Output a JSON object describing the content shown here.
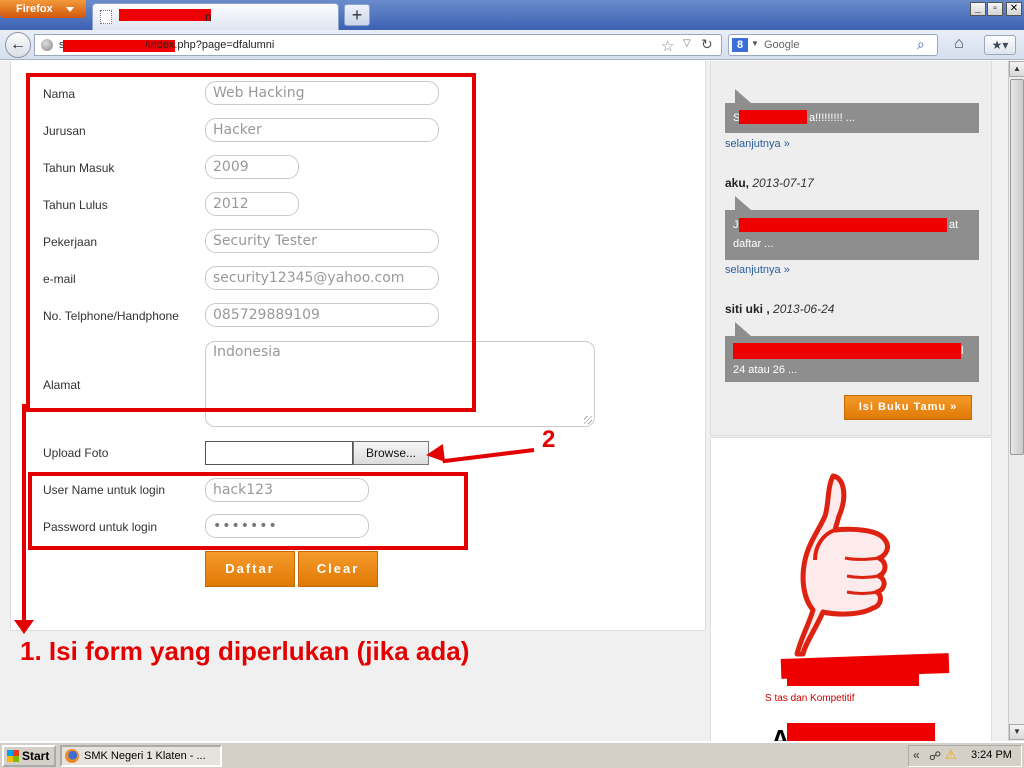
{
  "browser": {
    "app_button": "Firefox",
    "tab_title_tail": "n",
    "url_prefix": "s",
    "url_visible": "/index.php?page=dfalumni",
    "search_placeholder": "Google",
    "search_engine_letter": "8",
    "new_tab": "+",
    "window_controls": [
      "_",
      "▫",
      "✕"
    ]
  },
  "form": {
    "fields": [
      {
        "label": "Nama",
        "value": "Web Hacking"
      },
      {
        "label": "Jurusan",
        "value": "Hacker"
      },
      {
        "label": "Tahun Masuk",
        "value": "2009"
      },
      {
        "label": "Tahun Lulus",
        "value": "2012"
      },
      {
        "label": "Pekerjaan",
        "value": "Security Tester"
      },
      {
        "label": "e-mail",
        "value": "security12345@yahoo.com"
      },
      {
        "label": "No. Telphone/Handphone",
        "value": "085729889109"
      }
    ],
    "alamat_label": "Alamat",
    "alamat_value": "Indonesia",
    "upload_label": "Upload Foto",
    "browse_label": "Browse...",
    "username_label": "User Name untuk login",
    "username_value": "hack123",
    "password_label": "Password untuk login",
    "password_value": "•••••••",
    "submit_label": "Daftar",
    "clear_label": "Clear"
  },
  "annotations": {
    "step1_text": "1. Isi form yang diperlukan (jika ada)",
    "step2_num": "2"
  },
  "guestbook": {
    "entries": [
      {
        "author": "",
        "date": "",
        "text_start": "S",
        "text_end": "a!!!!!!!!! ..."
      },
      {
        "author": "aku,",
        "date": "2013-07-17",
        "text_start": "J",
        "text_end": "at",
        "text_line2": "daftar ..."
      },
      {
        "author": "siti uki ,",
        "date": "2013-06-24",
        "text_end": "l",
        "text_line2": "24 atau 26 ..."
      }
    ],
    "more_label": "selanjutnya »",
    "sign_button": "Isi Buku Tamu »"
  },
  "promo": {
    "tagline": "S                   tas dan Kompetitif",
    "big_letter": "A"
  },
  "taskbar": {
    "start_label": "Start",
    "task_label": "SMK Negeri 1 Klaten - ...",
    "tray_chevron": "«",
    "clock": "3:24 PM"
  },
  "colors": {
    "accent_orange": "#e88a12",
    "annotation_red": "#e30000",
    "bubble_gray": "#8e8e8e",
    "link_blue": "#2b5e9b"
  }
}
